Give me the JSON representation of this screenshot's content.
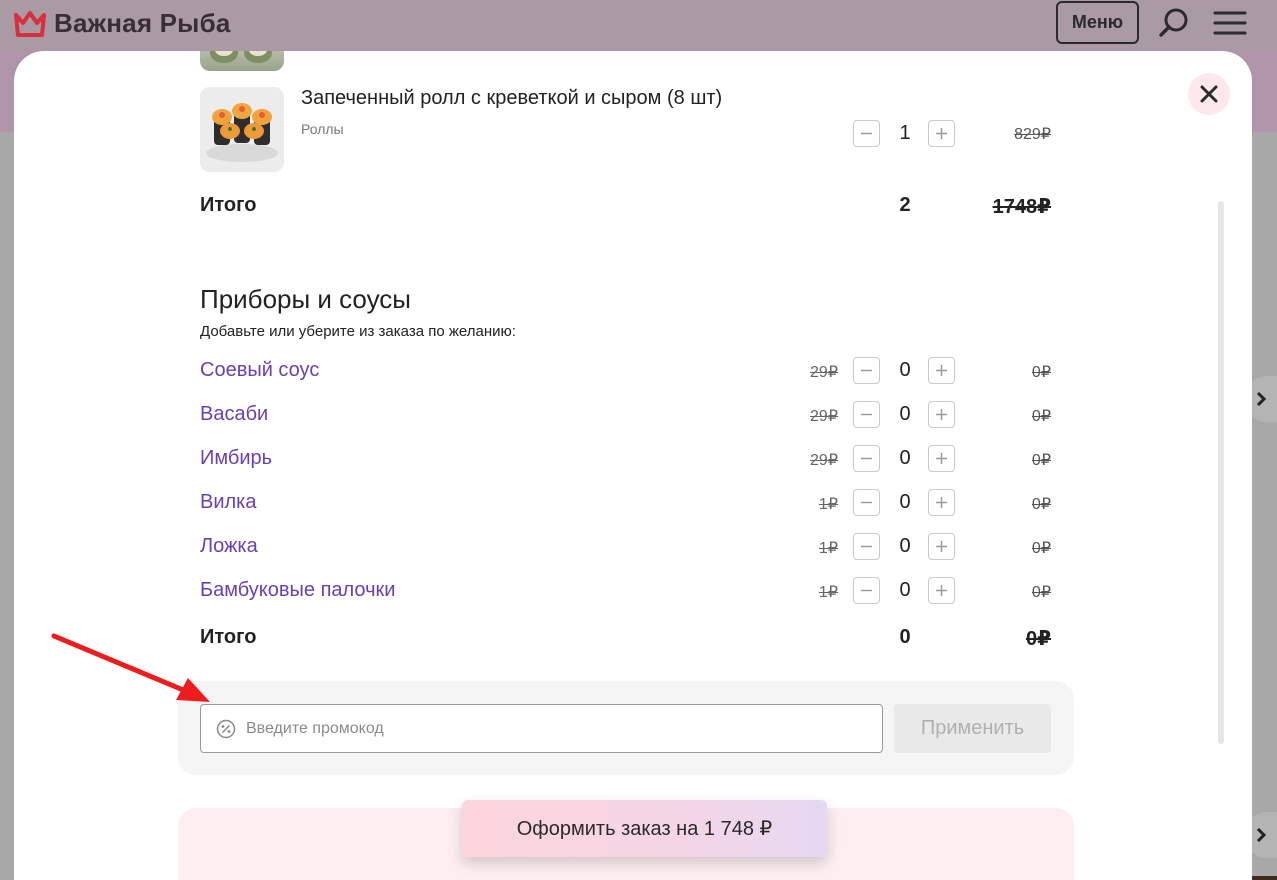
{
  "header": {
    "brand": "Важная Рыба",
    "menu_label": "Меню"
  },
  "cart": {
    "item": {
      "name": "Запеченный ролл с креветкой и сыром (8 шт)",
      "category": "Роллы",
      "quantity": "1",
      "price": "829₽"
    },
    "total": {
      "label": "Итого",
      "quantity": "2",
      "sum": "1748₽"
    }
  },
  "extras": {
    "title": "Приборы и соусы",
    "subtitle": "Добавьте или уберите из заказа по желанию:",
    "items": [
      {
        "name": "Соевый соус",
        "unit_price": "29₽",
        "quantity": "0",
        "sum": "0₽"
      },
      {
        "name": "Васаби",
        "unit_price": "29₽",
        "quantity": "0",
        "sum": "0₽"
      },
      {
        "name": "Имбирь",
        "unit_price": "29₽",
        "quantity": "0",
        "sum": "0₽"
      },
      {
        "name": "Вилка",
        "unit_price": "1₽",
        "quantity": "0",
        "sum": "0₽"
      },
      {
        "name": "Ложка",
        "unit_price": "1₽",
        "quantity": "0",
        "sum": "0₽"
      },
      {
        "name": "Бамбуковые палочки",
        "unit_price": "1₽",
        "quantity": "0",
        "sum": "0₽"
      }
    ],
    "total": {
      "label": "Итого",
      "quantity": "0",
      "sum": "0₽"
    }
  },
  "promo": {
    "placeholder": "Введите промокод",
    "value": "",
    "apply_label": "Применить"
  },
  "checkout": {
    "order_label": "Оформить заказ на 1 748 ₽"
  },
  "colors": {
    "accent": "#6a3fb5",
    "brand": "#d6303c",
    "close_bg": "#fde8ec"
  },
  "icons": {
    "logo": "crown-icon",
    "search": "search-icon",
    "menu": "hamburger-icon",
    "close": "close-icon",
    "promo": "percent-icon",
    "minus": "minus-icon",
    "plus": "plus-icon",
    "arrow": "chevron-right-icon"
  }
}
